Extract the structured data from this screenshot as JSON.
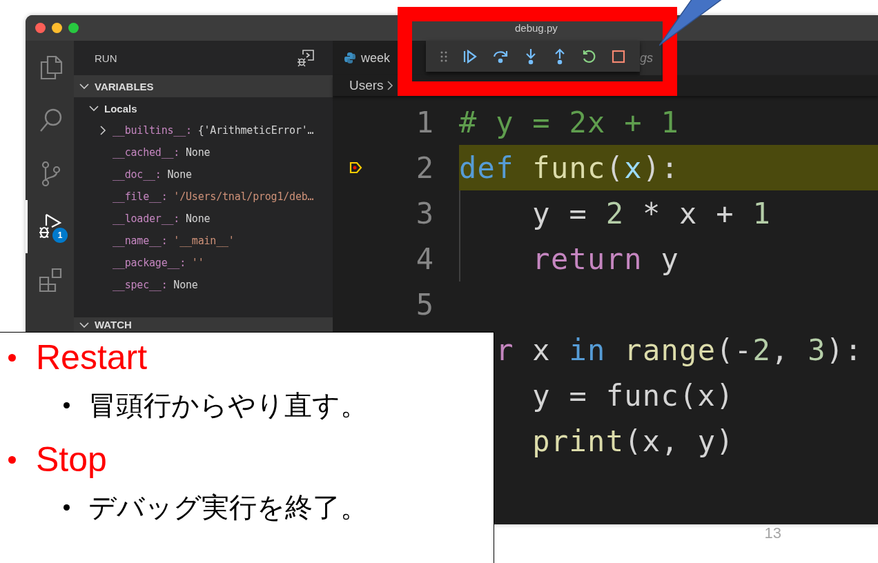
{
  "window": {
    "title": "debug.py"
  },
  "activity_bar": {
    "items": [
      {
        "kind": "files",
        "selected": false
      },
      {
        "kind": "search",
        "selected": false
      },
      {
        "kind": "source-control",
        "selected": false
      },
      {
        "kind": "run",
        "selected": true,
        "badge": "1"
      },
      {
        "kind": "extensions",
        "selected": false
      }
    ]
  },
  "sidebar": {
    "title": "RUN",
    "variables": {
      "title": "VARIABLES",
      "expanded": true,
      "scope": {
        "title": "Locals",
        "expanded": true,
        "items": [
          {
            "name": "__builtins__:",
            "value": "{'ArithmeticError'…",
            "kind": "object",
            "expanded": false
          },
          {
            "name": "__cached__:",
            "value": "None",
            "kind": "value"
          },
          {
            "name": "__doc__:",
            "value": "None",
            "kind": "value"
          },
          {
            "name": "__file__:",
            "value": "'/Users/tnal/prog1/deb…",
            "kind": "string"
          },
          {
            "name": "__loader__:",
            "value": "None",
            "kind": "value"
          },
          {
            "name": "__name__:",
            "value": "'__main__'",
            "kind": "string"
          },
          {
            "name": "__package__:",
            "value": "''",
            "kind": "string"
          },
          {
            "name": "__spec__:",
            "value": "None",
            "kind": "value"
          }
        ]
      }
    },
    "watch": {
      "title": "WATCH",
      "expanded": true
    }
  },
  "editor": {
    "tabs": [
      {
        "label": "week",
        "selected": true
      },
      {
        "label": "gs",
        "selected": false
      }
    ],
    "breadcrumb": [
      "Users"
    ],
    "lines": [
      {
        "number": "1",
        "current": false,
        "tokens": [
          {
            "kind": "comment",
            "text": "# y = 2x + 1"
          }
        ]
      },
      {
        "number": "2",
        "current": true,
        "tokens": [
          {
            "kind": "keyword",
            "text": "def"
          },
          {
            "kind": "function",
            "text": " func"
          },
          {
            "kind": "plain",
            "text": "("
          },
          {
            "kind": "param",
            "text": "x"
          },
          {
            "kind": "plain",
            "text": "):"
          }
        ]
      },
      {
        "number": "3",
        "current": false,
        "tokens": [
          {
            "kind": "plain",
            "text": "    y = "
          },
          {
            "kind": "number",
            "text": "2"
          },
          {
            "kind": "plain",
            "text": " * x + "
          },
          {
            "kind": "number",
            "text": "1"
          }
        ]
      },
      {
        "number": "4",
        "current": false,
        "tokens": [
          {
            "kind": "control",
            "text": "    return"
          },
          {
            "kind": "plain",
            "text": " y"
          }
        ]
      },
      {
        "number": "5",
        "current": false
      },
      {
        "current": false,
        "tokens": [
          {
            "kind": "control",
            "text": "  r"
          },
          {
            "kind": "plain",
            "text": " x "
          },
          {
            "kind": "keyword",
            "text": "in"
          },
          {
            "kind": "function",
            "text": " range"
          },
          {
            "kind": "plain",
            "text": "(-"
          },
          {
            "kind": "number",
            "text": "2"
          },
          {
            "kind": "plain",
            "text": ", "
          },
          {
            "kind": "number",
            "text": "3"
          },
          {
            "kind": "plain",
            "text": "):"
          }
        ]
      },
      {
        "current": false,
        "tokens": [
          {
            "kind": "plain",
            "text": "    y = func(x)"
          }
        ]
      },
      {
        "current": false,
        "tokens": [
          {
            "kind": "function",
            "text": "    print"
          },
          {
            "kind": "plain",
            "text": "(x, y)"
          }
        ]
      }
    ]
  },
  "debug_toolbar": {
    "buttons": [
      {
        "kind": "grip"
      },
      {
        "kind": "continue"
      },
      {
        "kind": "step-over"
      },
      {
        "kind": "step-into"
      },
      {
        "kind": "step-out"
      },
      {
        "kind": "restart"
      },
      {
        "kind": "stop"
      }
    ]
  },
  "callout": {
    "items": [
      {
        "title": "Restart",
        "description": "冒頭行からやり直す。"
      },
      {
        "title": "Stop",
        "description": "デバッグ実行を終了。"
      }
    ]
  },
  "page_number": "13"
}
